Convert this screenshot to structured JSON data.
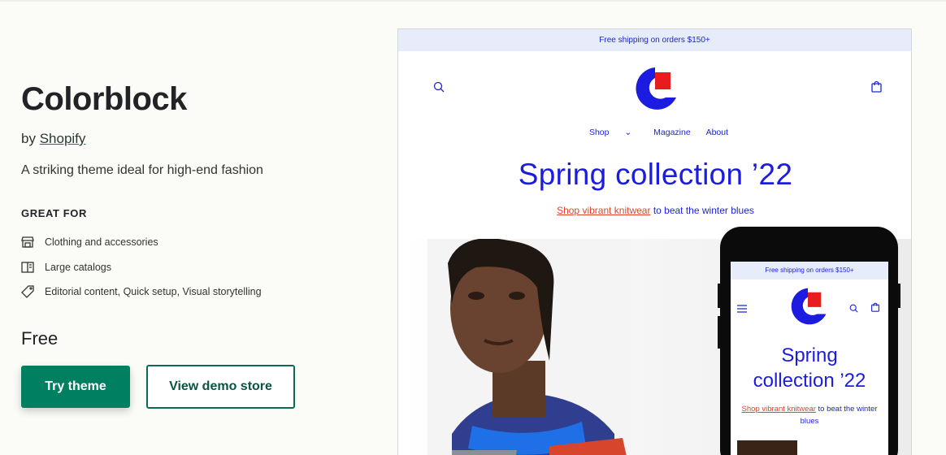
{
  "theme": {
    "name": "Colorblock",
    "by_prefix": "by",
    "author": "Shopify",
    "tagline": "A striking theme ideal for high-end fashion",
    "great_for_heading": "GREAT FOR",
    "features": [
      {
        "icon": "store-icon",
        "label": "Clothing and accessories"
      },
      {
        "icon": "catalog-icon",
        "label": "Large catalogs"
      },
      {
        "icon": "tag-icon",
        "label": "Editorial content, Quick setup, Visual storytelling"
      }
    ],
    "price": "Free",
    "try_button": "Try theme",
    "demo_button": "View demo store"
  },
  "preview": {
    "announcement": "Free shipping on orders $150+",
    "nav": [
      "Shop",
      "Magazine",
      "About"
    ],
    "hero_title": "Spring collection ’22",
    "hero_link": "Shop vibrant knitwear",
    "hero_sub_rest": " to beat the winter blues",
    "mobile": {
      "announcement": "Free shipping on orders $150+",
      "title_line1": "Spring",
      "title_line2": "collection ’22",
      "link": "Shop vibrant knitwear",
      "sub_rest": " to beat the winter blues"
    }
  },
  "colors": {
    "brand_green": "#008060",
    "store_blue": "#1c1ce0",
    "store_red": "#e0442b",
    "announcement_bg": "#e6ecfa"
  }
}
